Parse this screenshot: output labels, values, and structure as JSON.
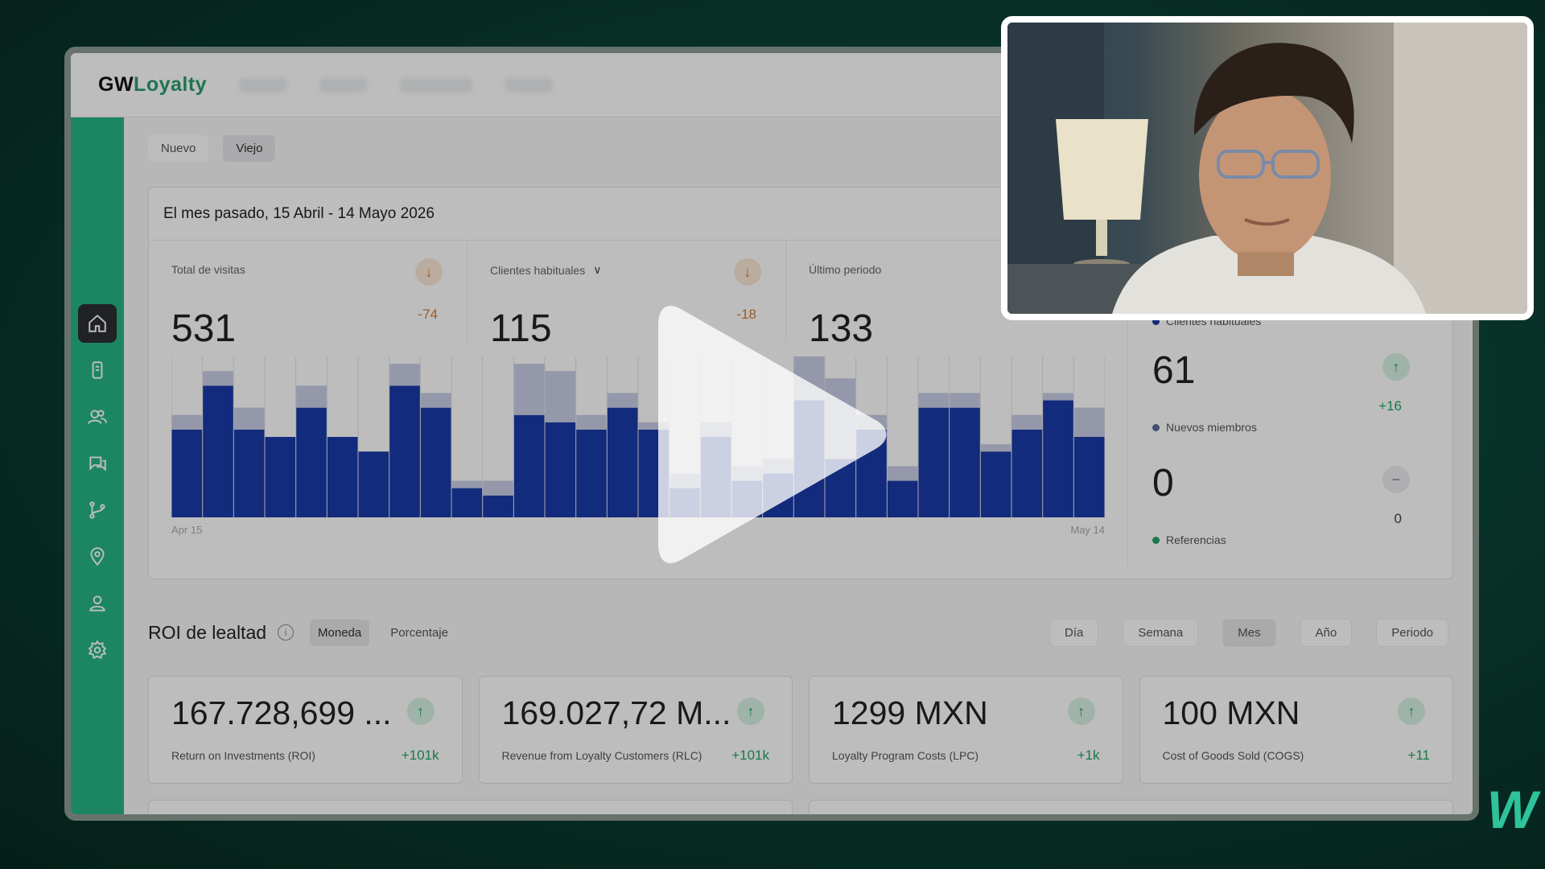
{
  "app": {
    "logo_gw": "GW",
    "logo_loyalty": "Loyalty"
  },
  "sidebar": {
    "items": [
      {
        "icon": "home-icon",
        "active": true
      },
      {
        "icon": "device-icon",
        "active": false
      },
      {
        "icon": "users-icon",
        "active": false
      },
      {
        "icon": "chat-icon",
        "active": false
      },
      {
        "icon": "branch-icon",
        "active": false
      },
      {
        "icon": "location-icon",
        "active": false
      },
      {
        "icon": "user-icon",
        "active": false
      },
      {
        "icon": "gear-icon",
        "active": false
      }
    ]
  },
  "toggle": {
    "new_label": "Nuevo",
    "old_label": "Viejo",
    "selected": "Viejo"
  },
  "panel": {
    "date_range": "El mes pasado, 15 Abril - 14 Mayo 2026",
    "stats": [
      {
        "label": "Total de visitas",
        "value": "531",
        "delta": "-74",
        "direction": "down"
      },
      {
        "label": "Clientes habituales",
        "value": "115",
        "delta": "-18",
        "direction": "down"
      },
      {
        "label": "Último periodo",
        "value": "133",
        "delta": "",
        "direction": "none"
      }
    ]
  },
  "chart_data": {
    "type": "bar",
    "x_start_label": "Apr 15",
    "x_end_label": "May 14",
    "colors": {
      "main": "#1a3aa8",
      "top": "#c8cde6",
      "grid": "#e3e3e6"
    },
    "series": [
      {
        "values": [
          12,
          18,
          12,
          11,
          15,
          11,
          9,
          18,
          15,
          4,
          3,
          14,
          13,
          12,
          15,
          12,
          4,
          11,
          5,
          6,
          16,
          8,
          12,
          5,
          15,
          15,
          9,
          12,
          16,
          11
        ]
      },
      {
        "values": [
          2,
          2,
          3,
          0,
          3,
          0,
          0,
          3,
          2,
          1,
          2,
          7,
          7,
          2,
          2,
          1,
          2,
          2,
          2,
          2,
          8,
          11,
          2,
          2,
          2,
          2,
          1,
          2,
          1,
          4
        ]
      }
    ]
  },
  "side_stats": [
    {
      "legend": "Clientes habituales",
      "legend_color": "#1a3aa8",
      "value": "",
      "delta": "",
      "dir": "none"
    },
    {
      "legend": "Nuevos miembros",
      "legend_color": "#5a6a9a",
      "value": "61",
      "delta": "+16",
      "dir": "up"
    },
    {
      "legend": "Referencias",
      "legend_color": "#23a262",
      "value": "0",
      "delta": "0",
      "dir": "flat"
    }
  ],
  "roi": {
    "title": "ROI de lealtad",
    "info_icon": "info-icon",
    "modes": [
      "Moneda",
      "Porcentaje"
    ],
    "mode_selected": "Moneda",
    "periods": [
      "Día",
      "Semana",
      "Mes",
      "Año",
      "Periodo"
    ],
    "period_selected": "Mes",
    "cards": [
      {
        "value": "167.728,699 ...",
        "label": "Return on Investments (ROI)",
        "delta": "+101k"
      },
      {
        "value": "169.027,72 M...",
        "label": "Revenue from Loyalty Customers (RLC)",
        "delta": "+101k"
      },
      {
        "value": "1299 MXN",
        "label": "Loyalty Program Costs (LPC)",
        "delta": "+1k"
      },
      {
        "value": "100 MXN",
        "label": "Cost of Goods Sold (COGS)",
        "delta": "+11"
      }
    ]
  },
  "overlay": {
    "play_icon": "play-icon",
    "watermark": "W"
  }
}
